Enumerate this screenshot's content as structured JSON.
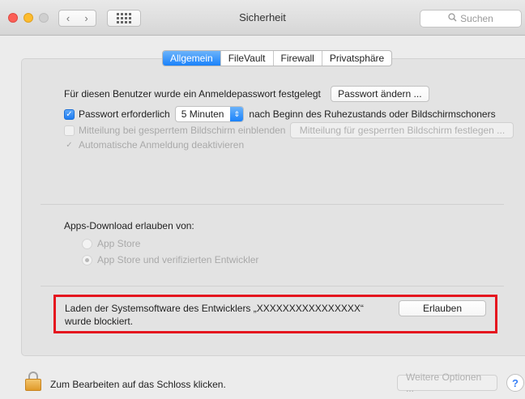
{
  "window": {
    "title": "Sicherheit"
  },
  "toolbar": {
    "back": "‹",
    "forward": "›",
    "search_placeholder": "Suchen"
  },
  "tabs": [
    {
      "label": "Allgemein",
      "active": true
    },
    {
      "label": "FileVault",
      "active": false
    },
    {
      "label": "Firewall",
      "active": false
    },
    {
      "label": "Privatsphäre",
      "active": false
    }
  ],
  "general": {
    "password_set_text": "Für diesen Benutzer wurde ein Anmeldepasswort festgelegt",
    "change_password_button": "Passwort ändern ...",
    "require_password_label": "Passwort erforderlich",
    "require_password_select": "5 Minuten",
    "require_password_suffix": "nach Beginn des Ruhezustands oder Bildschirmschoners",
    "show_message_label": "Mitteilung bei gesperrtem Bildschirm einblenden",
    "set_message_button": "Mitteilung für gesperrten Bildschirm festlegen ...",
    "disable_autologin_label": "Automatische Anmeldung deaktivieren"
  },
  "apps": {
    "heading": "Apps-Download erlauben von:",
    "option_app_store": "App Store",
    "option_app_store_identified": "App Store und verifizierten Entwickler",
    "selected": "App Store und verifizierten Entwickler"
  },
  "alert": {
    "line1": "Laden der Systemsoftware des Entwicklers „XXXXXXXXXXXXXXXX“",
    "line2": "wurde blockiert.",
    "allow_button": "Erlauben"
  },
  "footer": {
    "lock_text": "Zum Bearbeiten auf das Schloss klicken.",
    "advanced_button": "Weitere Optionen ...",
    "help_label": "?"
  },
  "colors": {
    "accent": "#1a82fb",
    "alert_border": "#e5141e"
  }
}
